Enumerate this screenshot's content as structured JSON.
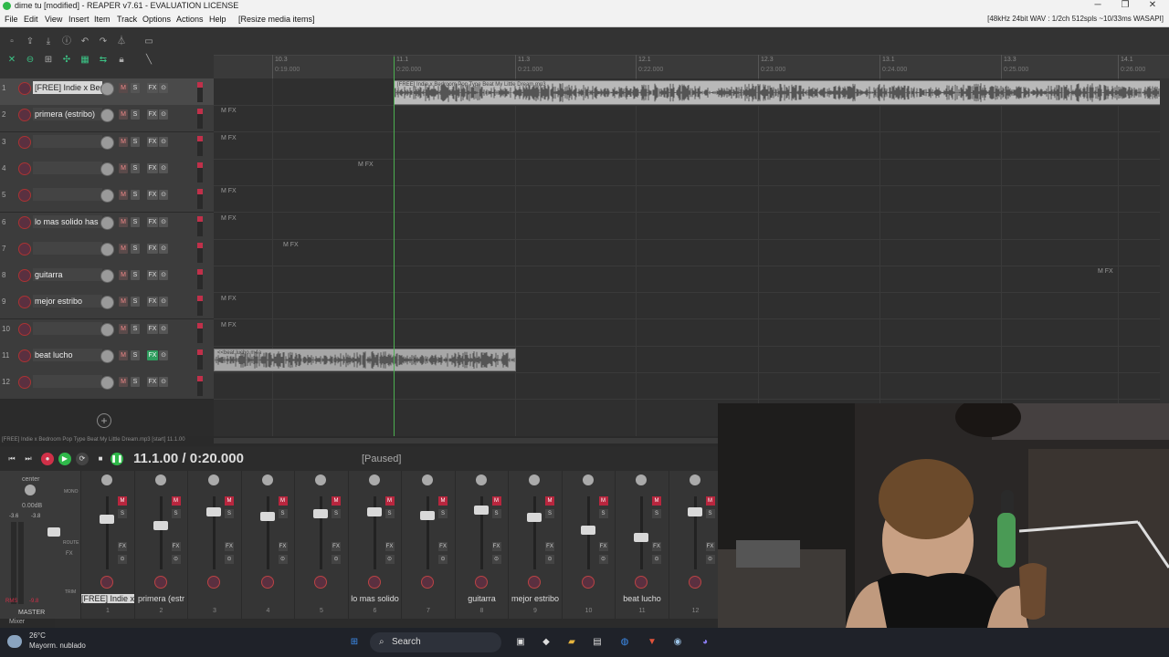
{
  "titlebar": {
    "title": "dime tu [modified] - REAPER v7.61 - EVALUATION LICENSE"
  },
  "menu": {
    "items": [
      "File",
      "Edit",
      "View",
      "Insert",
      "Item",
      "Track",
      "Options",
      "Actions",
      "Help",
      "[Resize media items]"
    ],
    "status": "[48kHz 24bit WAV : 1/2ch 512spls ~10/33ms WASAPI]"
  },
  "ruler": {
    "markers": [
      "10.3",
      "11.1",
      "11.3",
      "12.1",
      "12.3",
      "13.1",
      "13.3",
      "14.1"
    ],
    "times": [
      "0:19.000",
      "0:20.000",
      "0:21.000",
      "0:22.000",
      "0:23.000",
      "0:24.000",
      "0:25.000",
      "0:26.000"
    ]
  },
  "tracks": [
    {
      "num": "1",
      "name": "[FREE] Indie x Bed",
      "fx_on": false
    },
    {
      "num": "2",
      "name": "primera (estribo)",
      "fx_on": false
    },
    {
      "num": "3",
      "name": "",
      "fx_on": false
    },
    {
      "num": "4",
      "name": "",
      "fx_on": false
    },
    {
      "num": "5",
      "name": "",
      "fx_on": false
    },
    {
      "num": "6",
      "name": "lo mas solido has",
      "fx_on": false
    },
    {
      "num": "7",
      "name": "",
      "fx_on": false
    },
    {
      "num": "8",
      "name": "guitarra",
      "fx_on": false
    },
    {
      "num": "9",
      "name": "mejor estribo",
      "fx_on": false
    },
    {
      "num": "10",
      "name": "",
      "fx_on": false
    },
    {
      "num": "11",
      "name": "beat lucho",
      "fx_on": true
    },
    {
      "num": "12",
      "name": "",
      "fx_on": false
    }
  ],
  "buttons": {
    "mute": "M",
    "solo": "S",
    "fx": "FX",
    "io": "⊙"
  },
  "clips": {
    "main": "[FREE] Indie x Bedroom Pop Type Beat My Little Dream.mp3",
    "beat": "<<beat lucho.m4a"
  },
  "item_icons": "M FX",
  "source_line": "[FREE] Indie x Bedroom Pop Type Beat My Little Dream.mp3 [start] 11.1.00",
  "transport": {
    "timecode": "11.1.00 / 0:20.000",
    "state": "[Paused]"
  },
  "mixer": {
    "master_label": "MASTER",
    "master_pan": "center",
    "master_db": "0.00dB",
    "master_left": "-3.6",
    "master_right": "-3.8",
    "master_rms": "RMS",
    "master_rms_val": "-9.8",
    "side_labels": [
      "MONO",
      "FX",
      "ROUTE",
      "TRIM"
    ],
    "strips": [
      {
        "label": "[FREE] Indie x",
        "idx": "1",
        "sel": true
      },
      {
        "label": "primera (estr",
        "idx": "2",
        "sel": false
      },
      {
        "label": "",
        "idx": "3",
        "sel": false
      },
      {
        "label": "",
        "idx": "4",
        "sel": false
      },
      {
        "label": "",
        "idx": "5",
        "sel": false
      },
      {
        "label": "lo mas solido",
        "idx": "6",
        "sel": false
      },
      {
        "label": "",
        "idx": "7",
        "sel": false
      },
      {
        "label": "guitarra",
        "idx": "8",
        "sel": false
      },
      {
        "label": "mejor estribo",
        "idx": "9",
        "sel": false
      },
      {
        "label": "",
        "idx": "10",
        "sel": false
      },
      {
        "label": "beat lucho",
        "idx": "11",
        "sel": false
      },
      {
        "label": "",
        "idx": "12",
        "sel": false
      }
    ],
    "tab": "Mixer"
  },
  "taskbar": {
    "temp": "26°C",
    "weather": "Mayorm. nublado",
    "search": "Search"
  },
  "colors": {
    "accent": "#2fb84a",
    "record": "#d03048",
    "selected": "#d8d8d8"
  }
}
